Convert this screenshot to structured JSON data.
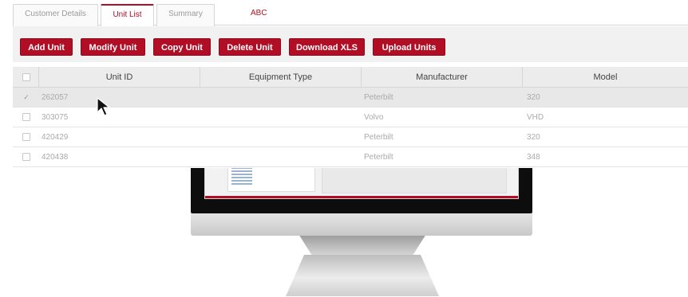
{
  "tabs": [
    {
      "label": "Customer Details",
      "active": false
    },
    {
      "label": "Unit List",
      "active": true
    },
    {
      "label": "Summary",
      "active": false
    }
  ],
  "account_tab": "ABC",
  "toolbar": {
    "buttons": [
      "Add Unit",
      "Modify Unit",
      "Copy Unit",
      "Delete Unit",
      "Download XLS",
      "Upload Units"
    ]
  },
  "table": {
    "columns": [
      "Unit ID",
      "Equipment Type",
      "Manufacturer",
      "Model"
    ],
    "rows": [
      {
        "selected": true,
        "unit_id": "262057",
        "equipment_type": "",
        "manufacturer": "Peterbilt",
        "model": "320"
      },
      {
        "selected": false,
        "unit_id": "303075",
        "equipment_type": "",
        "manufacturer": "Volvo",
        "model": "VHD"
      },
      {
        "selected": false,
        "unit_id": "420429",
        "equipment_type": "",
        "manufacturer": "Peterbilt",
        "model": "320"
      },
      {
        "selected": false,
        "unit_id": "420438",
        "equipment_type": "",
        "manufacturer": "Peterbilt",
        "model": "348"
      }
    ]
  },
  "colors": {
    "accent": "#b10d25",
    "toolbar_bg": "#f1f1f1",
    "selected_row": "#e8e8e8"
  },
  "icons": {
    "row_check": "checkmark-icon",
    "pointer": "mouse-cursor-icon"
  }
}
